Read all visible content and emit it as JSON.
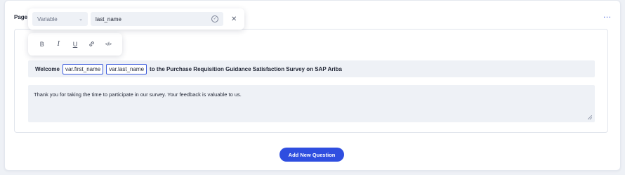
{
  "page": {
    "label": "Page",
    "more_icon": "…"
  },
  "variable_popup": {
    "type_value": "Variable",
    "name_value": "last_name"
  },
  "format_toolbar": {
    "bold": "B",
    "italic": "I",
    "underline": "U",
    "link": "↗",
    "code": "</>"
  },
  "question": {
    "title_prefix": "Welcome",
    "var1": "var.first_name",
    "var2": "var.last_name",
    "title_suffix": "to the Purchase Requisition Guidance Satisfaction Survey on SAP Ariba",
    "description": "Thank you for taking the time to participate in our survey. Your feedback is valuable to us."
  },
  "actions": {
    "add_question_label": "Add New Question"
  },
  "colors": {
    "accent": "#2f4ee0",
    "field_bg": "#eef1f6",
    "chip_border": "#3b5bdb"
  }
}
